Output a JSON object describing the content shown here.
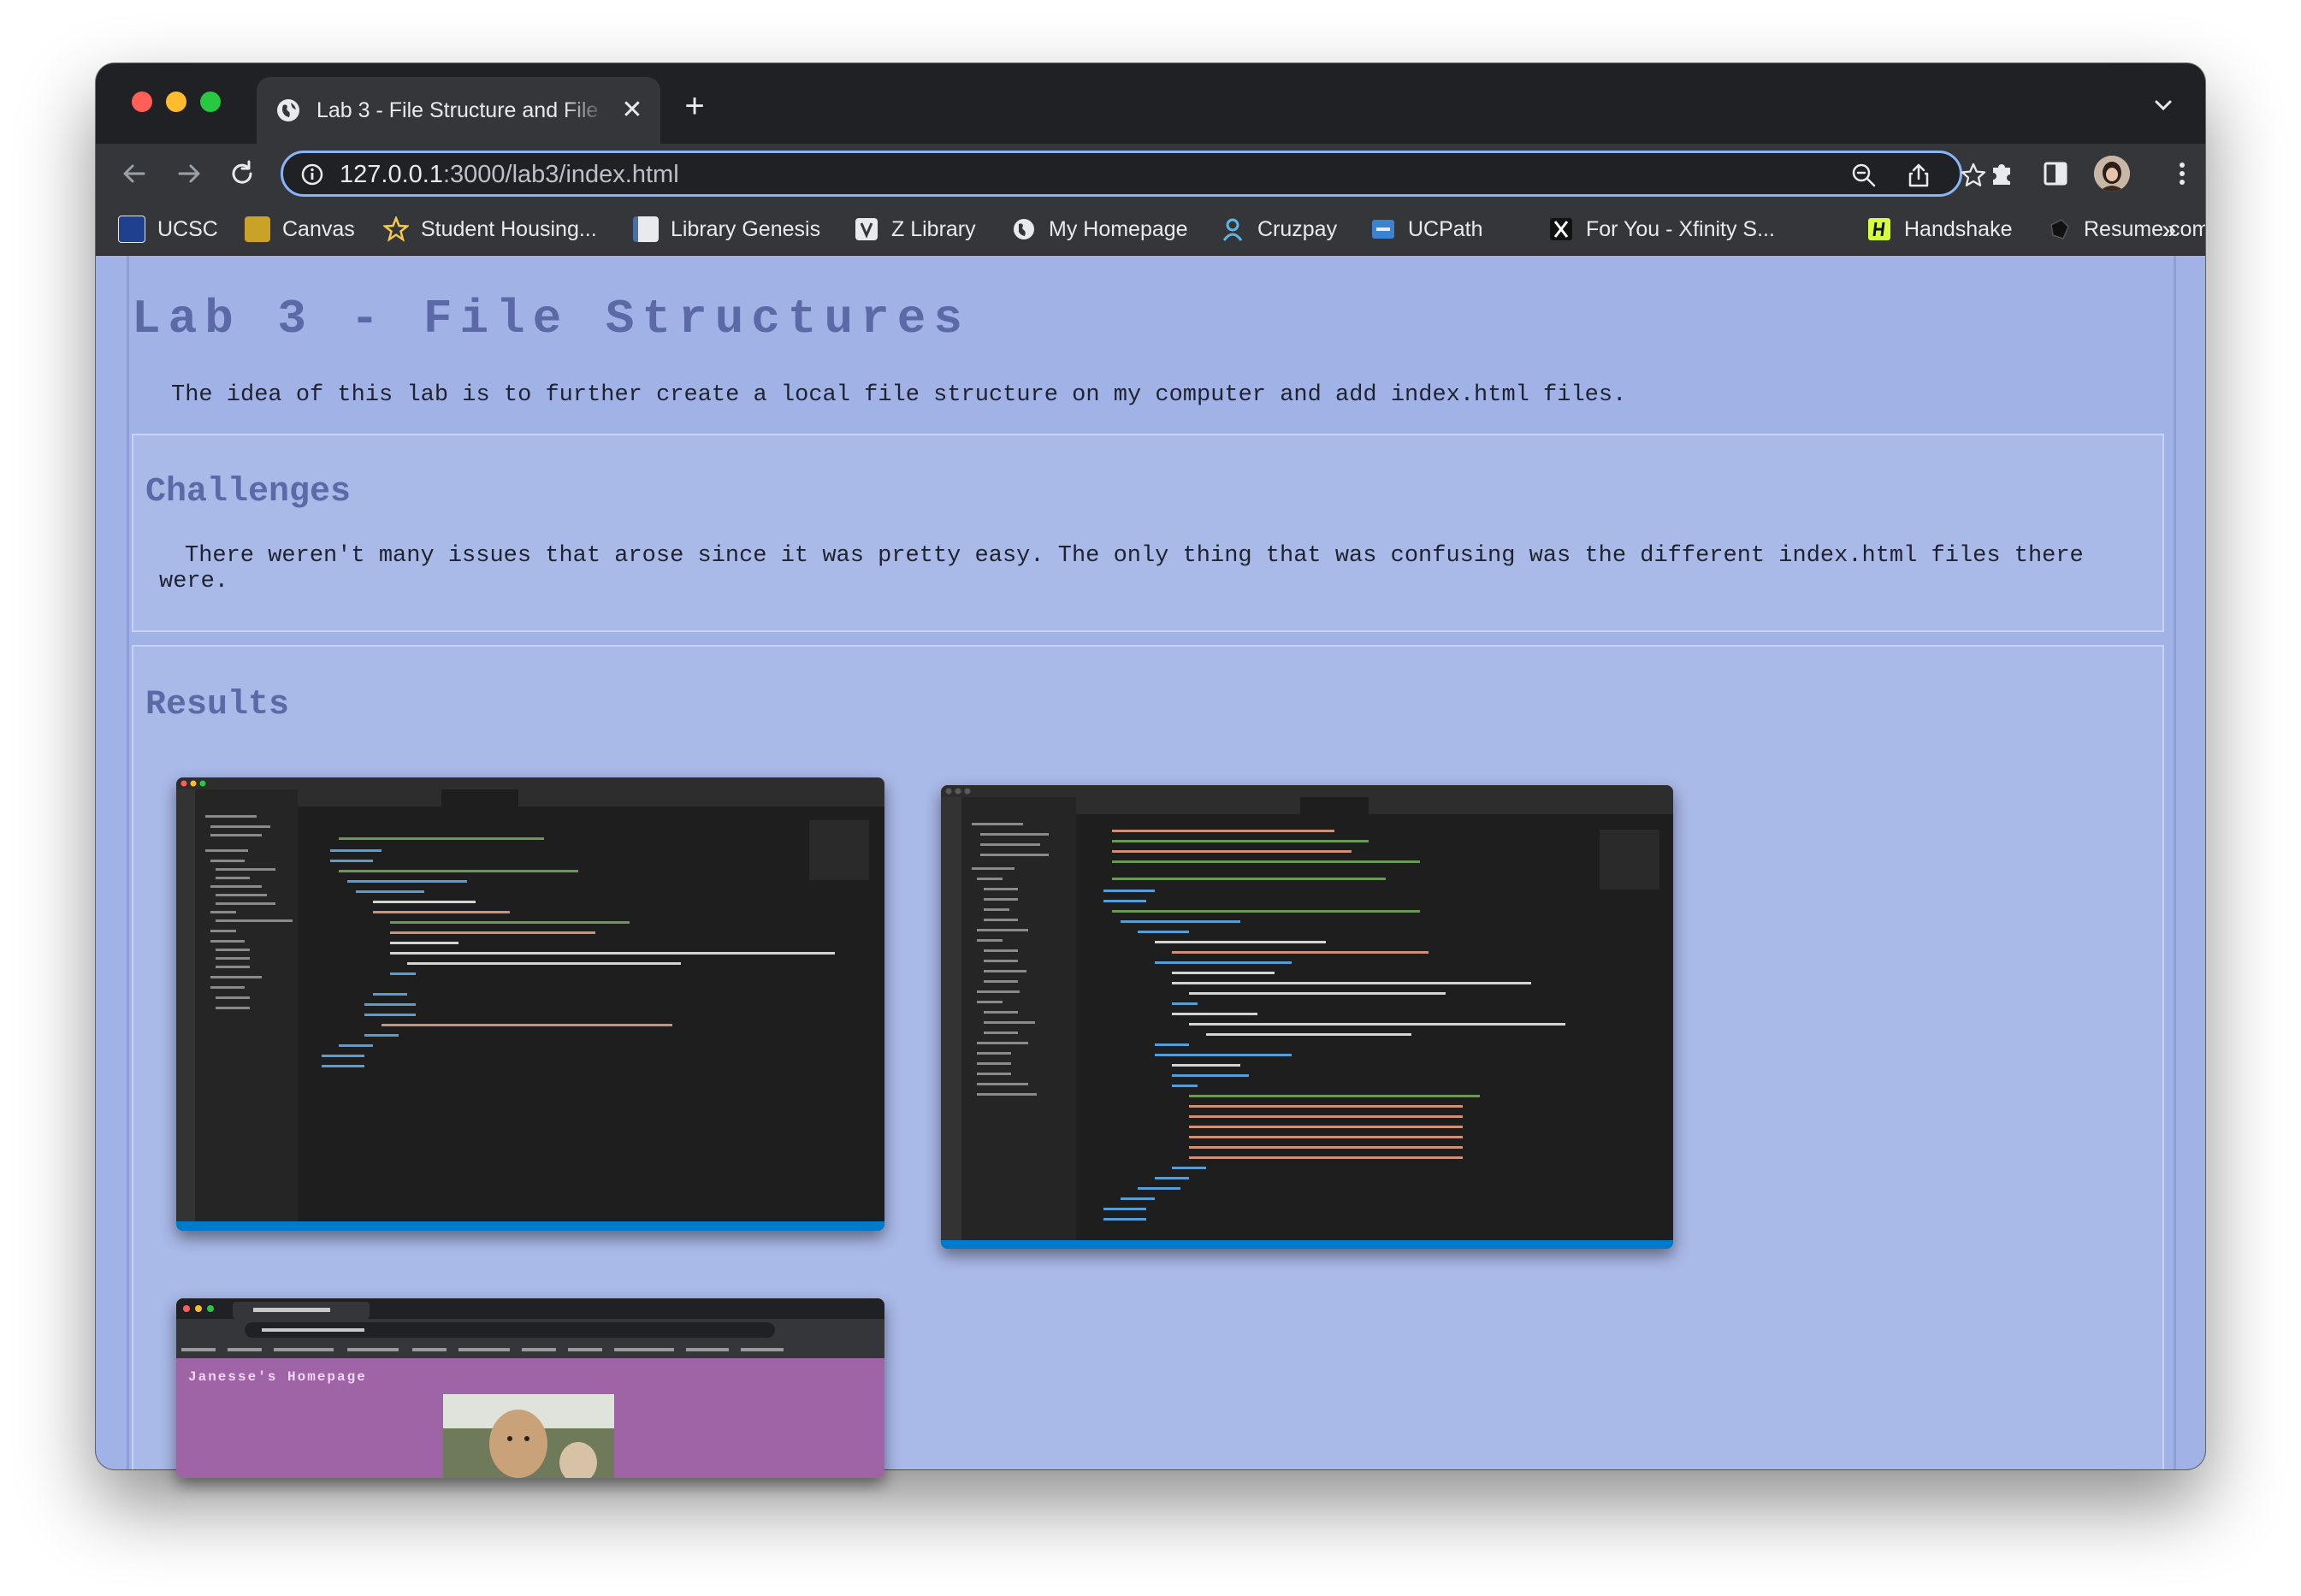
{
  "browser": {
    "tab_title": "Lab 3 - File Structure and File",
    "url_host": "127.0.0.1",
    "url_rest": ":3000/lab3/index.html"
  },
  "bookmarks": [
    {
      "label": "UCSC",
      "icon": "ucsc-icon",
      "color": "#1f3f8f"
    },
    {
      "label": "Canvas",
      "icon": "canvas-icon",
      "color": "#c9a227"
    },
    {
      "label": "Student Housing...",
      "icon": "star-icon",
      "color": "#f2c94c"
    },
    {
      "label": "Library Genesis",
      "icon": "book-icon",
      "color": "#4a6fa5"
    },
    {
      "label": "Z Library",
      "icon": "z-library-icon",
      "color": "#e8eaed"
    },
    {
      "label": "My Homepage",
      "icon": "globe-icon",
      "color": "#e8eaed"
    },
    {
      "label": "Cruzpay",
      "icon": "person-icon",
      "color": "#5fb7e8"
    },
    {
      "label": "UCPath",
      "icon": "ucpath-icon",
      "color": "#3b82d0"
    },
    {
      "label": "For You - Xfinity S...",
      "icon": "x-icon",
      "color": "#ffffff"
    },
    {
      "label": "Handshake",
      "icon": "handshake-icon",
      "color": "#d4ff3a"
    },
    {
      "label": "Resume.com",
      "icon": "resume-icon",
      "color": "#111111"
    }
  ],
  "page": {
    "title": "Lab 3 - File Structures",
    "intro": "The idea of this lab is to further create a local file structure on my computer and add index.html files.",
    "challenges_title": "Challenges",
    "challenges_text": "There weren't many issues that arose since it was pretty easy. The only thing that was confusing was the different index.html files there were.",
    "results_title": "Results",
    "homepage_heading": "Janesse's Homepage"
  },
  "colors": {
    "background": "#a1b2e6",
    "heading": "#5b6aa6",
    "accent_focus": "#8ab4f8"
  }
}
